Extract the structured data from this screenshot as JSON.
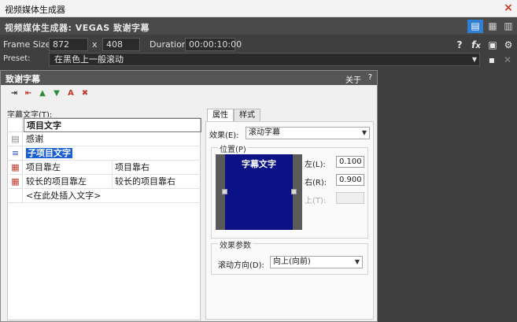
{
  "window": {
    "title": "视频媒体生成器",
    "close": "×"
  },
  "header": {
    "title": "视频媒体生成器: VEGAS 致谢字幕"
  },
  "frame": {
    "size_label": "Frame Size:",
    "width": "872",
    "x": "x",
    "height": "408",
    "duration_label": "Duration:",
    "duration": "00:00:10:00"
  },
  "preset": {
    "label": "Preset:",
    "value": "在黑色上一般滚动"
  },
  "dialog": {
    "title": "致谢字幕",
    "about": "关于",
    "help": "?",
    "list_label": "字幕文字(T):",
    "rows": [
      {
        "text": "项目文字"
      },
      {
        "text": "感谢"
      },
      {
        "text": "子项目文字"
      },
      {
        "left": "项目靠左",
        "right": "项目靠右"
      },
      {
        "left": "较长的项目靠左",
        "right": "较长的项目靠右"
      },
      {
        "text": "<在此处插入文字>"
      }
    ],
    "tabs": {
      "props": "属性",
      "style": "样式"
    },
    "effect": {
      "label": "效果(E):",
      "value": "滚动字幕"
    },
    "position": {
      "label": "位置(P)",
      "preview_caption": "字幕文字",
      "left_label": "左(L):",
      "left_value": "0.100",
      "right_label": "右(R):",
      "right_value": "0.900",
      "top_label": "上(T):"
    },
    "params": {
      "label": "效果参数",
      "scroll_label": "滚动方向(D):",
      "scroll_value": "向上(向前)"
    }
  }
}
